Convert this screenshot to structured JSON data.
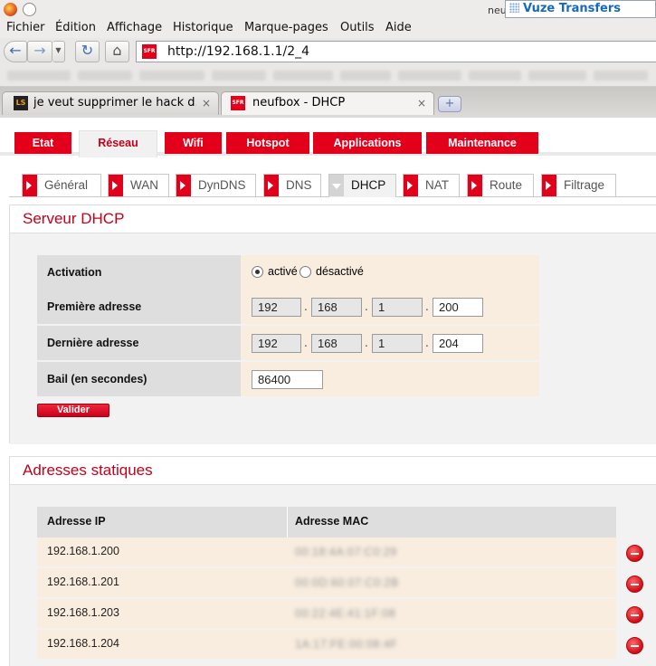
{
  "browser": {
    "window_right_text": "neu",
    "vuze_label": "Vuze Transfers",
    "menu": [
      "Fichier",
      "Édition",
      "Affichage",
      "Historique",
      "Marque-pages",
      "Outils",
      "Aide"
    ],
    "url": "http://192.168.1.1/2_4",
    "tabs": [
      {
        "title": "je veut supprimer le hack d...",
        "close": "×"
      },
      {
        "title": "neufbox - DHCP",
        "close": "×"
      }
    ],
    "new_tab": "+",
    "favicon_ls": "LS",
    "favicon_sfr": "SFR"
  },
  "main_nav": [
    {
      "label": "Etat",
      "active": false
    },
    {
      "label": "Réseau",
      "active": true
    },
    {
      "label": "Wifi",
      "active": false
    },
    {
      "label": "Hotspot",
      "active": false
    },
    {
      "label": "Applications",
      "active": false
    },
    {
      "label": "Maintenance",
      "active": false
    }
  ],
  "sub_nav": [
    {
      "label": "Général",
      "active": false
    },
    {
      "label": "WAN",
      "active": false
    },
    {
      "label": "DynDNS",
      "active": false
    },
    {
      "label": "DNS",
      "active": false
    },
    {
      "label": "DHCP",
      "active": true
    },
    {
      "label": "NAT",
      "active": false
    },
    {
      "label": "Route",
      "active": false
    },
    {
      "label": "Filtrage",
      "active": false
    }
  ],
  "dhcp": {
    "title": "Serveur DHCP",
    "activation_label": "Activation",
    "active_label": "activé",
    "inactive_label": "désactivé",
    "activation_value": "activé",
    "first_label": "Première adresse",
    "first_ip": [
      "192",
      "168",
      "1",
      "200"
    ],
    "last_label": "Dernière adresse",
    "last_ip": [
      "192",
      "168",
      "1",
      "204"
    ],
    "lease_label": "Bail (en secondes)",
    "lease_value": "86400",
    "validate_label": "Valider"
  },
  "static": {
    "title": "Adresses statiques",
    "col_ip": "Adresse IP",
    "col_mac": "Adresse MAC",
    "rows": [
      {
        "ip": "192.168.1.200",
        "mac": "00:18:4A:07:C0:29"
      },
      {
        "ip": "192.168.1.201",
        "mac": "00:0D:60:07:C0:2B"
      },
      {
        "ip": "192.168.1.203",
        "mac": "00:22:4E:41:1F:08"
      },
      {
        "ip": "192.168.1.204",
        "mac": "1A:17:FE:00:08:4F"
      }
    ]
  },
  "colors": {
    "brand_red": "#e3001b",
    "title_red": "#c4001a",
    "row_bg": "#f9eddf",
    "label_bg": "#dedede"
  }
}
